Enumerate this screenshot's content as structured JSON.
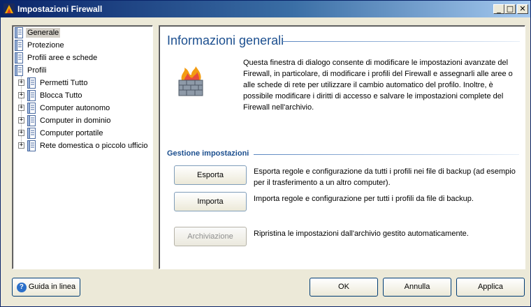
{
  "window": {
    "title": "Impostazioni Firewall",
    "controls": {
      "minimize": "_",
      "maximize": "□",
      "close": "✕"
    }
  },
  "sidebar": {
    "items": [
      {
        "label": "Generale",
        "selected": true,
        "icon": "settings-page-icon",
        "level": 0,
        "expandable": false
      },
      {
        "label": "Protezione",
        "selected": false,
        "icon": "settings-page-icon",
        "level": 0,
        "expandable": false
      },
      {
        "label": "Profili aree e schede",
        "selected": false,
        "icon": "settings-page-icon",
        "level": 0,
        "expandable": false
      },
      {
        "label": "Profili",
        "selected": false,
        "icon": "settings-page-icon",
        "level": 0,
        "expandable": false
      },
      {
        "label": "Permetti Tutto",
        "selected": false,
        "icon": "settings-page-icon",
        "level": 1,
        "expandable": true
      },
      {
        "label": "Blocca Tutto",
        "selected": false,
        "icon": "settings-page-icon",
        "level": 1,
        "expandable": true
      },
      {
        "label": "Computer autonomo",
        "selected": false,
        "icon": "settings-page-icon",
        "level": 1,
        "expandable": true
      },
      {
        "label": "Computer in dominio",
        "selected": false,
        "icon": "settings-page-icon",
        "level": 1,
        "expandable": true
      },
      {
        "label": "Computer portatile",
        "selected": false,
        "icon": "settings-page-icon",
        "level": 1,
        "expandable": true
      },
      {
        "label": "Rete domestica o piccolo ufficio",
        "selected": false,
        "icon": "settings-page-icon",
        "level": 1,
        "expandable": true
      }
    ]
  },
  "main": {
    "title": "Informazioni generali",
    "icon": "firewall-icon",
    "intro": "Questa finestra di dialogo consente di modificare le impostazioni avanzate del Firewall, in particolare, di modificare i profili del Firewall e assegnarli alle aree o alle schede di rete per utilizzare il cambio automatico del profilo. Inoltre, è possibile modificare i diritti di accesso e salvare le impostazioni complete del Firewall nell'archivio.",
    "section_title": "Gestione impostazioni",
    "actions": [
      {
        "label": "Esporta",
        "description": "Esporta regole e configurazione da tutti i profili nei file di backup (ad esempio per il trasferimento a un altro computer).",
        "enabled": true
      },
      {
        "label": "Importa",
        "description": "Importa regole e configurazione per tutti i profili da file di backup.",
        "enabled": true
      },
      {
        "label": "Archiviazione",
        "description": "Ripristina le impostazioni dall'archivio gestito automaticamente.",
        "enabled": false
      }
    ]
  },
  "footer": {
    "help_label": "Guida in linea",
    "help_icon_glyph": "?",
    "ok_label": "OK",
    "cancel_label": "Annulla",
    "apply_label": "Applica"
  },
  "colors": {
    "titlebar_start": "#0a246a",
    "heading_blue": "#1c4f8f",
    "dialog_bg": "#ece9d8"
  }
}
